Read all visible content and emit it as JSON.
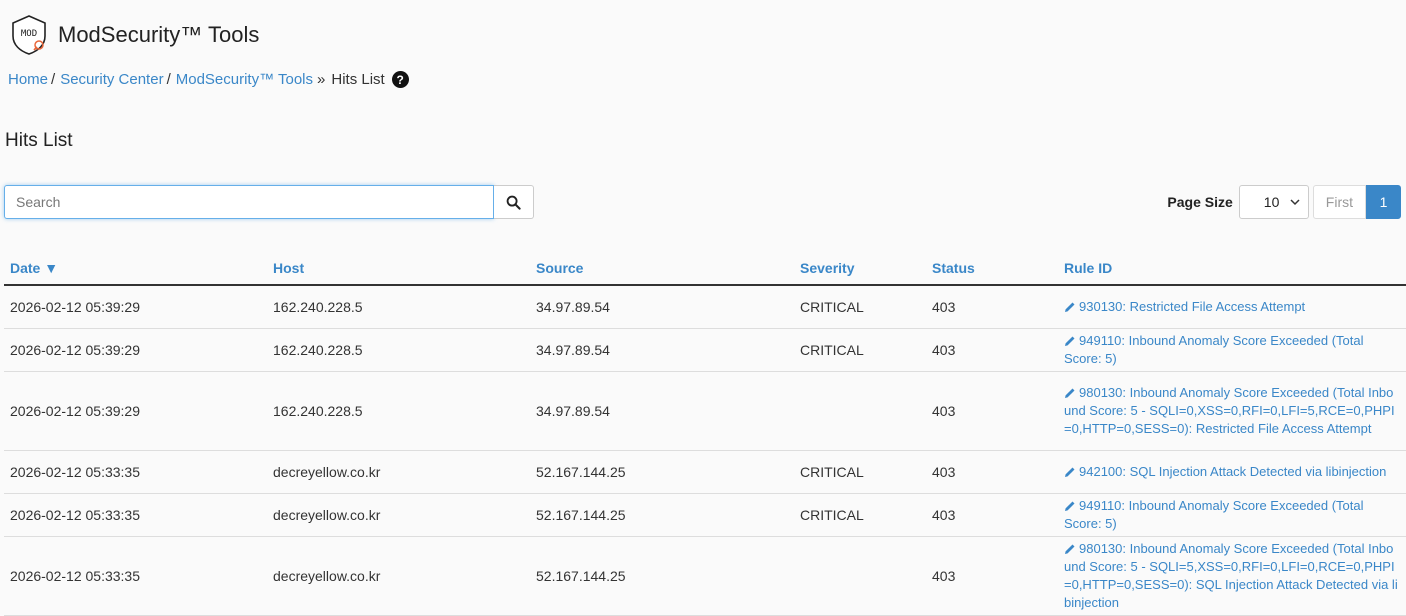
{
  "app": {
    "title": "ModSecurity™ Tools",
    "logo_text": "MOD"
  },
  "breadcrumb": {
    "home": "Home",
    "security_center": "Security Center",
    "modsec_tools": "ModSecurity™ Tools",
    "current": "Hits List",
    "sep": "/",
    "sep_final": "»"
  },
  "page": {
    "title": "Hits List"
  },
  "search": {
    "placeholder": "Search"
  },
  "paging": {
    "page_size_label": "Page Size",
    "page_size_value": "10",
    "first_label": "First",
    "current_page": "1"
  },
  "table": {
    "columns": {
      "date": "Date ▼",
      "host": "Host",
      "source": "Source",
      "severity": "Severity",
      "status": "Status",
      "rule_id": "Rule ID"
    },
    "rows": [
      {
        "date": "2026-02-12 05:39:29",
        "host": "162.240.228.5",
        "source": "34.97.89.54",
        "severity": "CRITICAL",
        "status": "403",
        "rule": "930130: Restricted File Access Attempt"
      },
      {
        "date": "2026-02-12 05:39:29",
        "host": "162.240.228.5",
        "source": "34.97.89.54",
        "severity": "CRITICAL",
        "status": "403",
        "rule": "949110: Inbound Anomaly Score Exceeded (Total Score: 5)"
      },
      {
        "date": "2026-02-12 05:39:29",
        "host": "162.240.228.5",
        "source": "34.97.89.54",
        "severity": "",
        "status": "403",
        "rule": "980130: Inbound Anomaly Score Exceeded (Total Inbound Score: 5 - SQLI=0,XSS=0,RFI=0,LFI=5,RCE=0,PHPI=0,HTTP=0,SESS=0): Restricted File Access Attempt"
      },
      {
        "date": "2026-02-12 05:33:35",
        "host": "decreyellow.co.kr",
        "source": "52.167.144.25",
        "severity": "CRITICAL",
        "status": "403",
        "rule": "942100: SQL Injection Attack Detected via libinjection"
      },
      {
        "date": "2026-02-12 05:33:35",
        "host": "decreyellow.co.kr",
        "source": "52.167.144.25",
        "severity": "CRITICAL",
        "status": "403",
        "rule": "949110: Inbound Anomaly Score Exceeded (Total Score: 5)"
      },
      {
        "date": "2026-02-12 05:33:35",
        "host": "decreyellow.co.kr",
        "source": "52.167.144.25",
        "severity": "",
        "status": "403",
        "rule": "980130: Inbound Anomaly Score Exceeded (Total Inbound Score: 5 - SQLI=5,XSS=0,RFI=0,LFI=0,RCE=0,PHPI=0,HTTP=0,SESS=0): SQL Injection Attack Detected via libinjection"
      }
    ]
  },
  "colors": {
    "link": "#3a87c8",
    "active_page": "#3a87c8",
    "logo_accent": "#e8663a"
  },
  "icons": {
    "logo": "modsecurity-shield-icon",
    "help": "question-circle-icon",
    "search": "magnifier-icon",
    "rule": "pencil-icon",
    "select": "chevron-down-icon"
  }
}
